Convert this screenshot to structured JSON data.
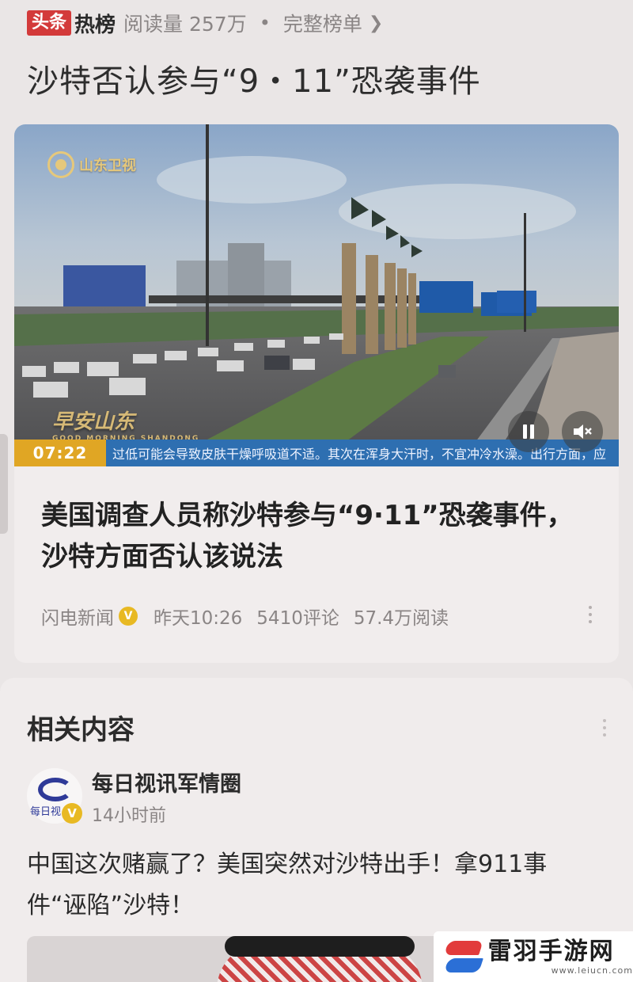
{
  "hot_header": {
    "brand_red": "头条",
    "brand_black": "热榜",
    "views": "阅读量 257万",
    "dot": "•",
    "full_list": "完整榜单"
  },
  "headline": "沙特否认参与“9・11”恐袭事件",
  "video": {
    "channel_logo": "山东卫视",
    "program_logo": "早安山东",
    "program_logo_sub": "GOOD MORNING SHANDONG",
    "time": "07:22",
    "ticker": "过低可能会导致皮肤干燥呼吸道不适。其次在浑身大汗时，不宜冲冷水澡。出行方面，应"
  },
  "article": {
    "title": "美国调查人员称沙特参与“9·11”恐袭事件，沙特方面否认该说法",
    "source": "闪电新闻",
    "verified_badge": "V",
    "time": "昨天10:26",
    "comments": "5410评论",
    "reads": "57.4万阅读"
  },
  "related": {
    "title": "相关内容",
    "source_name": "每日视讯军情圈",
    "avatar_text": "每日视",
    "verified_badge": "V",
    "time": "14小时前",
    "headline": "中国这次赌赢了？美国突然对沙特出手！拿911事件“诬陷”沙特！"
  },
  "watermark": {
    "title": "雷羽手游网",
    "url": "www.leiucn.com"
  },
  "colors": {
    "brand_red": "#d33a3a",
    "ticker_blue": "#2e6fb1",
    "time_orange": "#e0a624",
    "verified_gold": "#e8b923"
  },
  "icons": [
    "chevron-right-icon",
    "pause-icon",
    "mute-icon",
    "more-icon",
    "verified-icon"
  ]
}
